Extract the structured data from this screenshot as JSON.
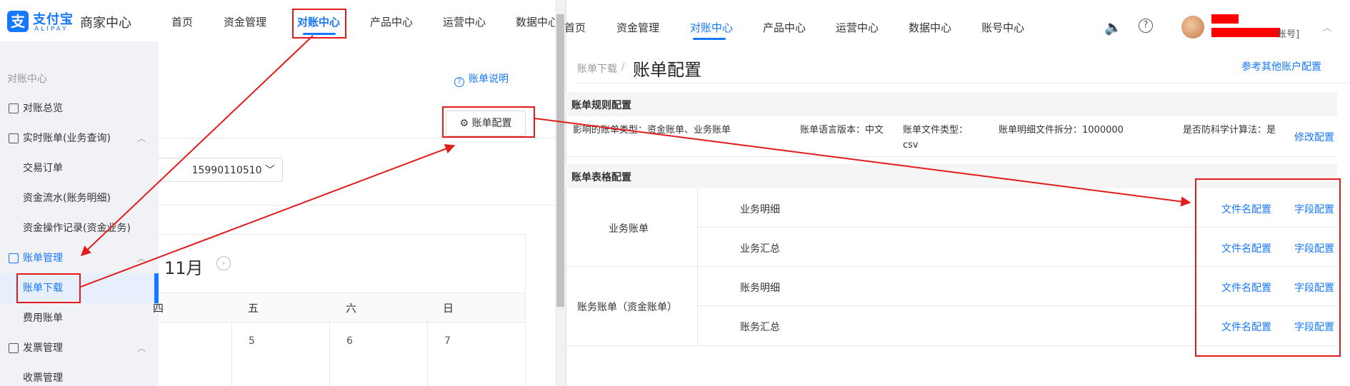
{
  "left": {
    "logo": {
      "cn": "支付宝",
      "en": "ALIPAY",
      "mark": "支"
    },
    "merchant_title": "商家中心",
    "nav": [
      "首页",
      "资金管理",
      "对账中心",
      "产品中心",
      "运营中心",
      "数据中心"
    ],
    "sidebar": {
      "section": "对账中心",
      "items": [
        {
          "label": "对账总览"
        },
        {
          "label": "实时账单(业务查询)"
        },
        {
          "label": "交易订单"
        },
        {
          "label": "资金流水(账务明细)"
        },
        {
          "label": "资金操作记录(资金业务)"
        },
        {
          "label": "账单管理"
        },
        {
          "label": "账单下载"
        },
        {
          "label": "费用账单"
        },
        {
          "label": "发票管理"
        },
        {
          "label": "收票管理"
        }
      ]
    },
    "bill_help": "账单说明",
    "bill_config_btn": "账单配置",
    "account_select": "15990110510",
    "calendar": {
      "month": "11月",
      "headers": [
        "四",
        "五",
        "六",
        "日"
      ],
      "days": [
        "5",
        "6",
        "7"
      ]
    }
  },
  "right": {
    "nav": [
      "首页",
      "资金管理",
      "对账中心",
      "产品中心",
      "运营中心",
      "数据中心",
      "账号中心"
    ],
    "account_suffix": "账号]",
    "breadcrumb_parent": "账单下载",
    "breadcrumb_sep": "/",
    "page_title": "账单配置",
    "ref_link": "参考其他账户配置",
    "rules": {
      "title": "账单规则配置",
      "bill_types": "影响的账单类型：资金账单、业务账单",
      "language": "账单语言版本：中文",
      "file_type": "账单文件类型：csv",
      "split": "账单明细文件拆分：1000000",
      "scientific": "是否防科学计算法：是",
      "modify_link": "修改配置"
    },
    "table": {
      "title": "账单表格配置",
      "groups": [
        {
          "name": "业务账单",
          "rows": [
            "业务明细",
            "业务汇总"
          ]
        },
        {
          "name": "账务账单（资金账单）",
          "rows": [
            "账务明细",
            "账务汇总"
          ]
        }
      ],
      "link_file": "文件名配置",
      "link_field": "字段配置"
    }
  },
  "colors": {
    "accent": "#1677ff",
    "annotation": "#e41b1b",
    "redaction": "#ff0000"
  }
}
